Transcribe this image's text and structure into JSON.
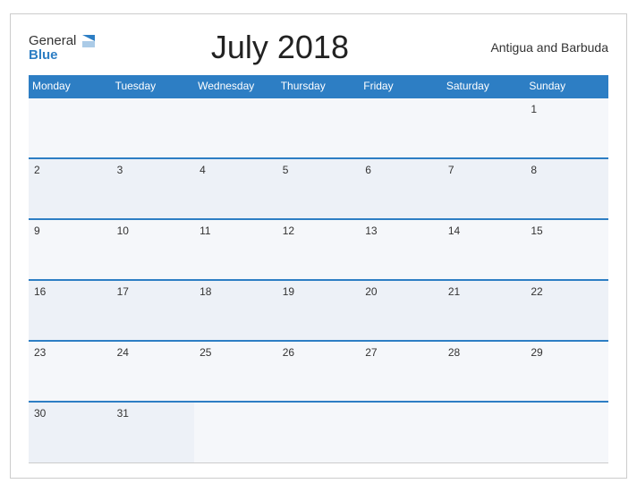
{
  "header": {
    "logo_general": "General",
    "logo_blue": "Blue",
    "title": "July 2018",
    "country": "Antigua and Barbuda"
  },
  "days_of_week": [
    "Monday",
    "Tuesday",
    "Wednesday",
    "Thursday",
    "Friday",
    "Saturday",
    "Sunday"
  ],
  "weeks": [
    [
      null,
      null,
      null,
      null,
      null,
      null,
      1
    ],
    [
      2,
      3,
      4,
      5,
      6,
      7,
      8
    ],
    [
      9,
      10,
      11,
      12,
      13,
      14,
      15
    ],
    [
      16,
      17,
      18,
      19,
      20,
      21,
      22
    ],
    [
      23,
      24,
      25,
      26,
      27,
      28,
      29
    ],
    [
      30,
      31,
      null,
      null,
      null,
      null,
      null
    ]
  ]
}
